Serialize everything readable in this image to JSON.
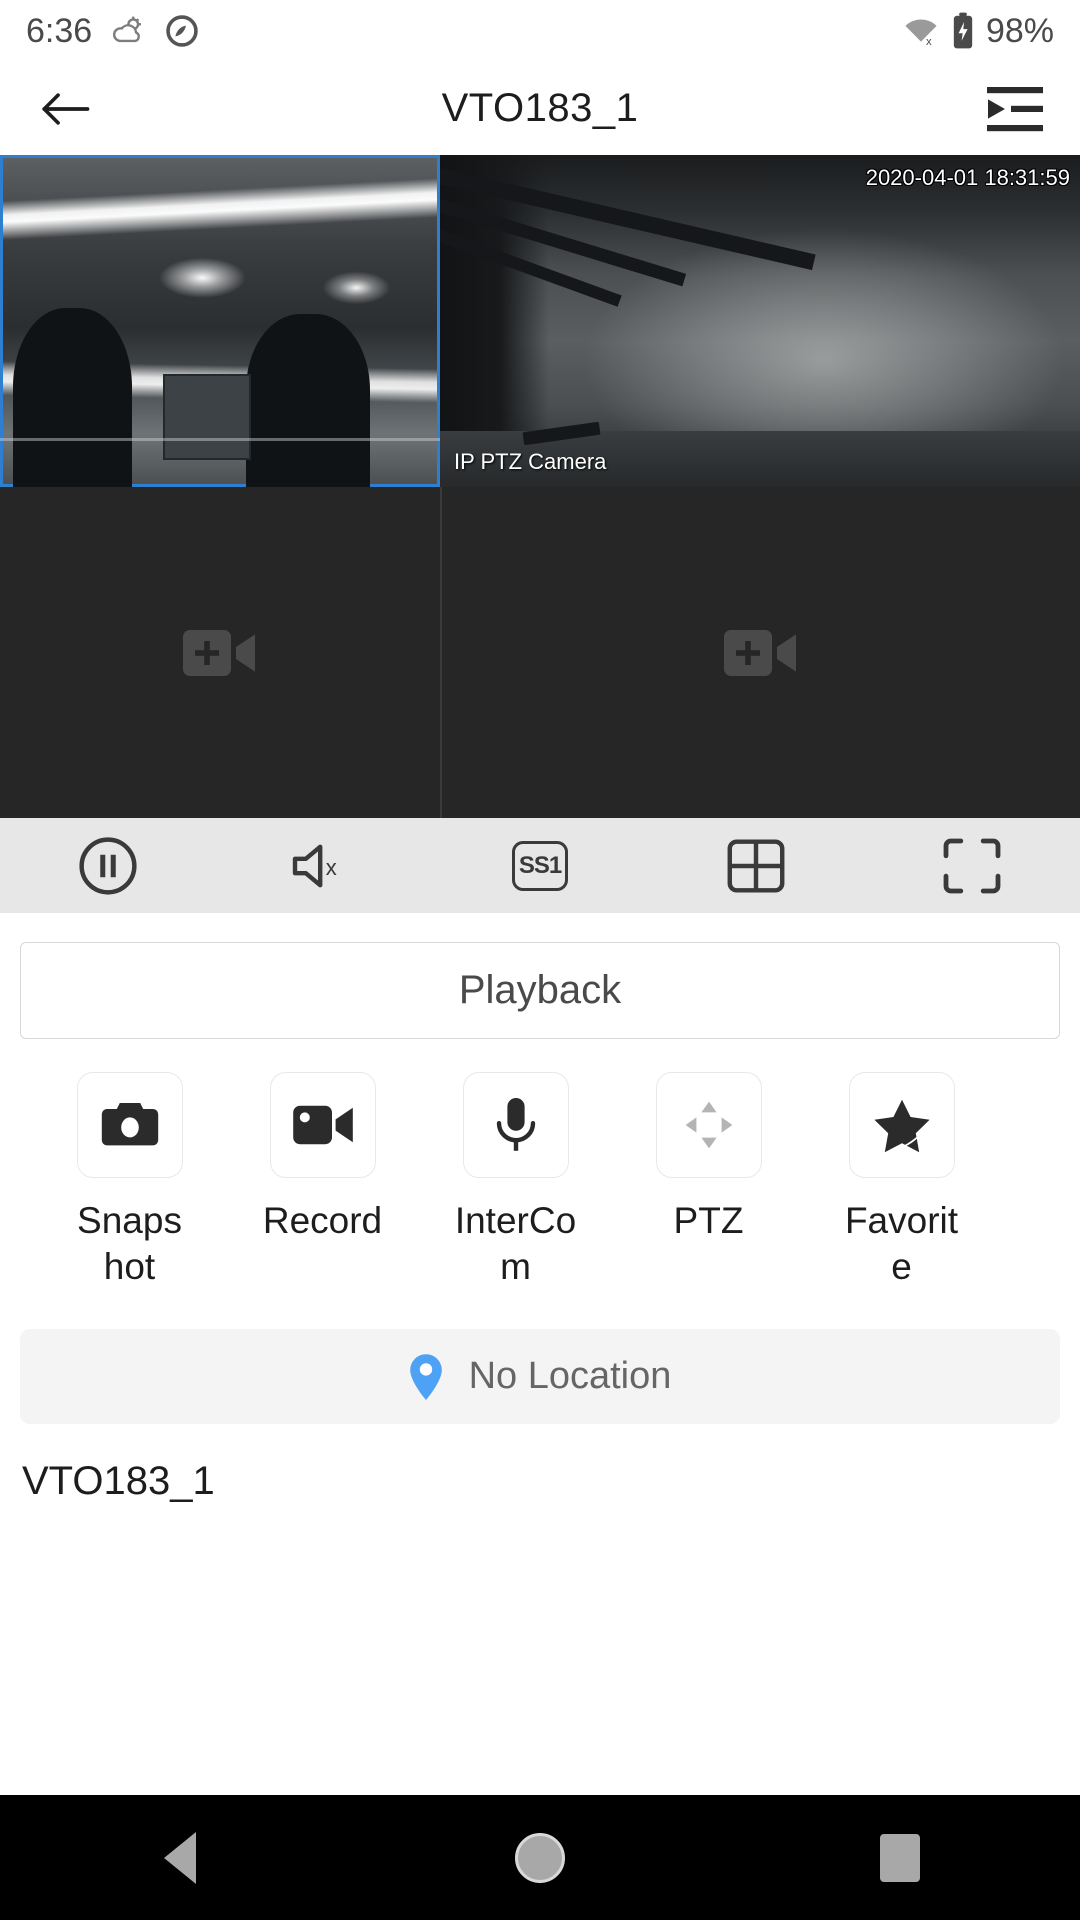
{
  "status_bar": {
    "time": "6:36",
    "battery_percent": "98%",
    "icons": [
      "weather-partly-cloudy-icon",
      "do-not-disturb-icon",
      "wifi-off-icon",
      "battery-charging-icon"
    ]
  },
  "app_bar": {
    "title": "VTO183_1",
    "back_icon": "arrow-left-icon",
    "menu_icon": "playlist-play-icon"
  },
  "video_grid": {
    "panes": [
      {
        "id": "pane-1",
        "selected": true,
        "state": "live",
        "osd_name": "",
        "osd_time": ""
      },
      {
        "id": "pane-2",
        "selected": false,
        "state": "live",
        "osd_name": "IP PTZ Camera",
        "osd_time": "2020-04-01 18:31:59"
      },
      {
        "id": "pane-3",
        "selected": false,
        "state": "empty",
        "placeholder_icon": "add-camera-icon"
      },
      {
        "id": "pane-4",
        "selected": false,
        "state": "empty",
        "placeholder_icon": "add-camera-icon"
      }
    ]
  },
  "control_bar": {
    "items": [
      {
        "name": "pause-button",
        "icon": "pause-circle-icon",
        "label": ""
      },
      {
        "name": "mute-button",
        "icon": "speaker-muted-icon",
        "label": ""
      },
      {
        "name": "stream-quality-button",
        "icon": "stream-quality-badge",
        "label": "SS1"
      },
      {
        "name": "layout-button",
        "icon": "grid-4-icon",
        "label": ""
      },
      {
        "name": "fullscreen-button",
        "icon": "fullscreen-icon",
        "label": ""
      }
    ]
  },
  "playback": {
    "label": "Playback"
  },
  "actions": [
    {
      "name": "snapshot",
      "label": "Snapshot",
      "icon": "camera-icon",
      "enabled": true
    },
    {
      "name": "record",
      "label": "Record",
      "icon": "video-camera-icon",
      "enabled": true
    },
    {
      "name": "intercom",
      "label": "InterCom",
      "icon": "microphone-icon",
      "enabled": true
    },
    {
      "name": "ptz",
      "label": "PTZ",
      "icon": "ptz-dpad-icon",
      "enabled": false
    },
    {
      "name": "favorite",
      "label": "Favorite",
      "icon": "star-icon",
      "enabled": true
    }
  ],
  "location": {
    "text": "No Location",
    "icon": "map-pin-icon",
    "pin_color": "#4da2f5"
  },
  "device": {
    "name": "VTO183_1"
  },
  "nav_bar": {
    "back": "back-triangle-icon",
    "home": "home-circle-icon",
    "recents": "recents-square-icon"
  },
  "colors": {
    "selection_border": "#2f7fd1",
    "control_bar_bg": "#e7e7e7",
    "location_bg": "#f4f4f4",
    "accent_blue": "#4da2f5"
  }
}
